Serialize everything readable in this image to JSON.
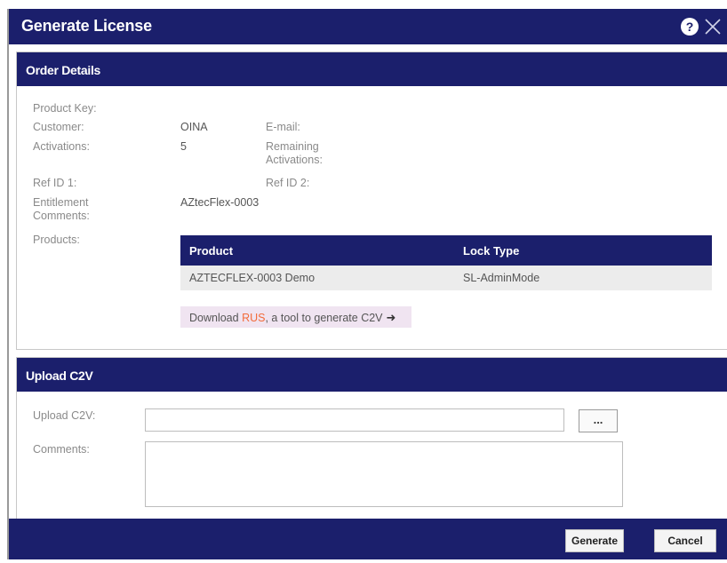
{
  "dialog": {
    "title": "Generate License",
    "help_icon": "help-circle-icon",
    "close_icon": "close-icon"
  },
  "order_details": {
    "header": "Order Details",
    "product_key_label": "Product Key:",
    "customer_label": "Customer:",
    "customer_value": "OINA",
    "email_label": "E-mail:",
    "activations_label": "Activations:",
    "activations_value": "5",
    "remaining_activations_label_line1": "Remaining",
    "remaining_activations_label_line2": "Activations:",
    "ref_id1_label": "Ref ID 1:",
    "ref_id2_label": "Ref ID 2:",
    "entitlement_comments_label_line1": "Entitlement",
    "entitlement_comments_label_line2": "Comments:",
    "entitlement_comments_value": "AZtecFlex-0003",
    "products_label": "Products:",
    "products_table": {
      "columns": [
        "Product",
        "Lock Type"
      ],
      "rows": [
        [
          "AZTECFLEX-0003 Demo",
          "SL-AdminMode"
        ]
      ]
    },
    "download": {
      "prefix": "Download ",
      "link": "RUS",
      "suffix": ", a tool to generate C2V",
      "icon": "arrow-right-icon"
    }
  },
  "upload_c2v": {
    "header": "Upload C2V",
    "upload_label": "Upload C2V:",
    "upload_value": "",
    "browse_label": "...",
    "comments_label": "Comments:",
    "comments_value": ""
  },
  "footer": {
    "generate_label": "Generate",
    "cancel_label": "Cancel"
  },
  "colors": {
    "primary": "#1b1f6c",
    "link_accent": "#f26b3a",
    "download_bg": "#f0e4f1"
  }
}
